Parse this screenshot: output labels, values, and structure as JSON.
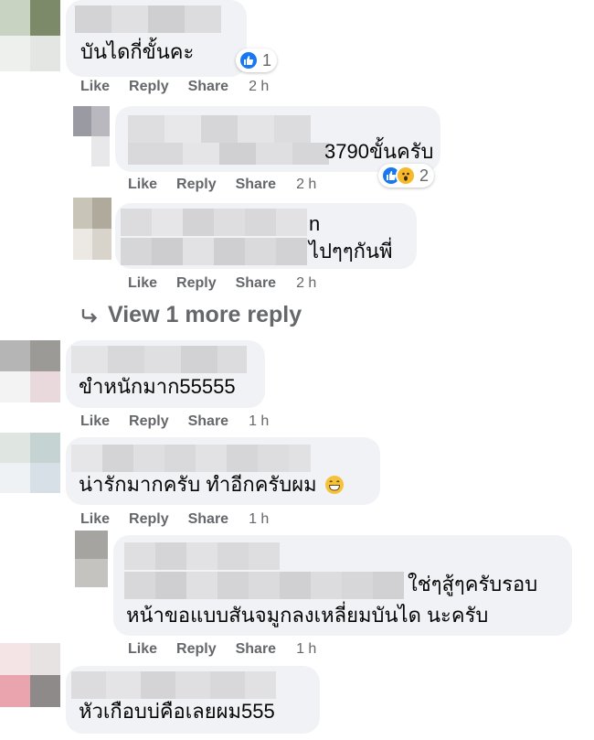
{
  "comments": [
    {
      "text": "บันไดกี่ขั้นคะ",
      "reaction_count": "1",
      "like": "Like",
      "reply": "Reply",
      "share": "Share",
      "time": "2 h"
    },
    {
      "text": "3790ขั้นครับ",
      "reaction_count": "2",
      "like": "Like",
      "reply": "Reply",
      "share": "Share",
      "time": "2 h"
    },
    {
      "text_line1": "n",
      "text_line2": "ไปๆๆกันพี่",
      "like": "Like",
      "reply": "Reply",
      "share": "Share",
      "time": "2 h"
    },
    {
      "text": "ขำหนักมาก55555",
      "like": "Like",
      "reply": "Reply",
      "share": "Share",
      "time": "1 h"
    },
    {
      "text": "น่ารักมากครับ ทำอีกครับผม",
      "emoji_icon": "grinning-face-icon",
      "like": "Like",
      "reply": "Reply",
      "share": "Share",
      "time": "1 h"
    },
    {
      "text_line1": "ใช่ๆสู้ๆครับรอบ",
      "text_line2": "หน้าขอแบบสันจมูกลงเหลี่ยมบันได นะครับ",
      "like": "Like",
      "reply": "Reply",
      "share": "Share",
      "time": "1 h"
    },
    {
      "text": "หัวเกือบบ่คือเลยผม555"
    }
  ],
  "view_more_replies": "View 1 more reply",
  "reaction_icons": [
    "like-icon",
    "wow-icon"
  ],
  "colors": {
    "bubble": "#f0f2f5",
    "muted": "#65676b",
    "like_blue": "#1877f2",
    "wow_yellow": "#f7b928"
  }
}
